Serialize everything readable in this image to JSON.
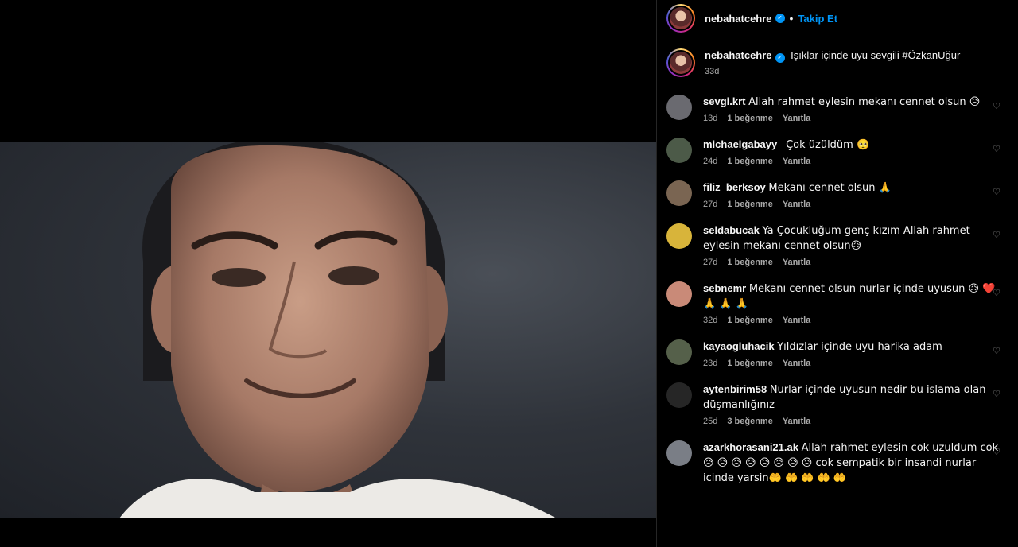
{
  "post": {
    "username": "nebahatcehre",
    "follow_label": "Takip Et",
    "dot": "•",
    "caption": "Işıklar içinde uyu sevgili #ÖzkanUğur",
    "caption_time": "33d"
  },
  "comments": [
    {
      "user": "sevgi.krt",
      "text": "Allah rahmet eylesin mekanı cennet olsun 😥",
      "time": "13d",
      "likes": "1 beğenme",
      "reply": "Yanıtla",
      "avatar_color": "#6a6a70"
    },
    {
      "user": "michaelgabayy_",
      "text": "Çok üzüldüm 🥺",
      "time": "24d",
      "likes": "1 beğenme",
      "reply": "Yanıtla",
      "avatar_color": "#4c5a48"
    },
    {
      "user": "filiz_berksoy",
      "text": "Mekanı cennet olsun 🙏",
      "time": "27d",
      "likes": "1 beğenme",
      "reply": "Yanıtla",
      "avatar_color": "#7a6552"
    },
    {
      "user": "seldabucak",
      "text": "Ya Çocukluğum genç kızım Allah rahmet eylesin mekanı cennet olsun😥",
      "time": "27d",
      "likes": "1 beğenme",
      "reply": "Yanıtla",
      "avatar_color": "#d8b43a"
    },
    {
      "user": "sebnemr",
      "text": "Mekanı cennet olsun nurlar içinde uyusun 😥 ❤️ 🙏 🙏 🙏",
      "time": "32d",
      "likes": "1 beğenme",
      "reply": "Yanıtla",
      "avatar_color": "#c98a78"
    },
    {
      "user": "kayaogluhacik",
      "text": "Yıldızlar içinde uyu harika adam",
      "time": "23d",
      "likes": "1 beğenme",
      "reply": "Yanıtla",
      "avatar_color": "#55604a"
    },
    {
      "user": "aytenbirim58",
      "text": "Nurlar içinde uyusun nedir bu islama olan düşmanlığınız",
      "time": "25d",
      "likes": "3 beğenme",
      "reply": "Yanıtla",
      "avatar_color": "#262626"
    },
    {
      "user": "azarkhorasani21.ak",
      "text": "Allah rahmet eylesin cok uzuldum cok😥 😥 😥 😥 😥 😥 😥 😥 cok sempatik bir insandi nurlar icinde yarsin🤲 🤲 🤲 🤲 🤲",
      "time": "",
      "likes": "",
      "reply": "",
      "avatar_color": "#7a7e86"
    }
  ],
  "icons": {
    "heart": "heart-outline-icon",
    "verified": "verified-badge-icon"
  },
  "colors": {
    "accent": "#0095f6",
    "background": "#000000",
    "muted": "#a8a8a8"
  }
}
